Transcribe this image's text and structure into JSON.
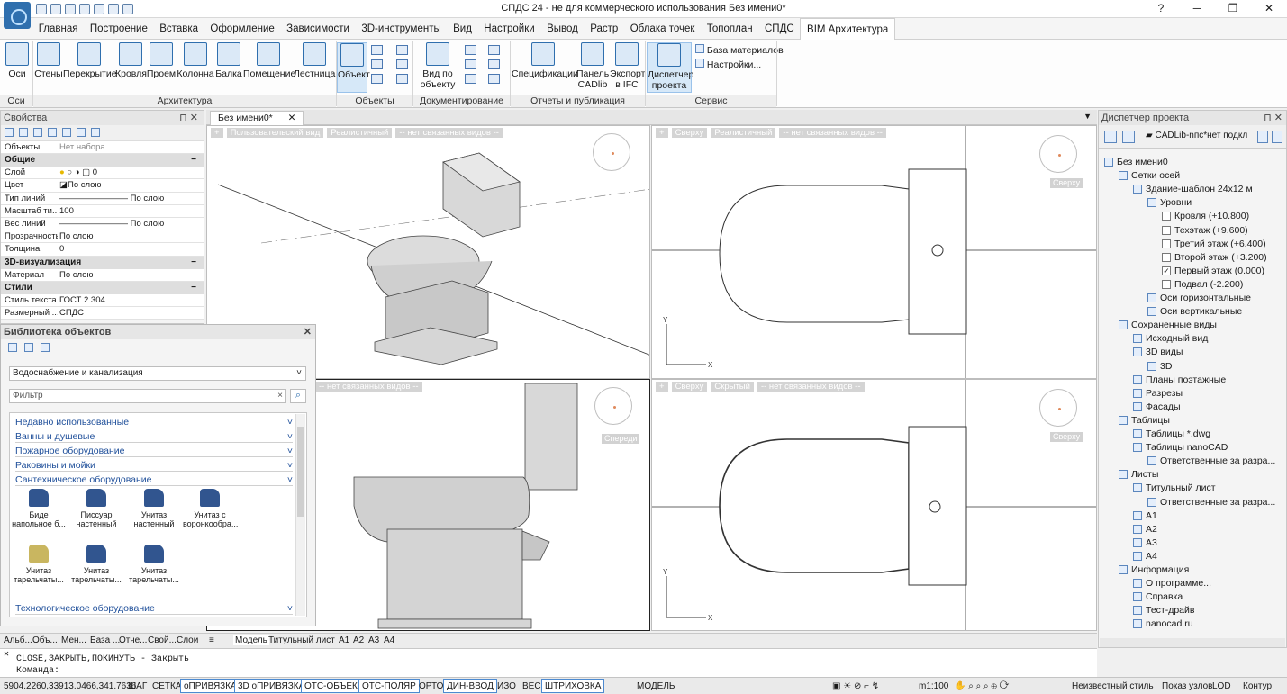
{
  "app": {
    "title": "СПДС 24 - не для коммерческого использования Без имени0*"
  },
  "menu": [
    "Главная",
    "Построение",
    "Вставка",
    "Оформление",
    "Зависимости",
    "3D-инструменты",
    "Вид",
    "Настройки",
    "Вывод",
    "Растр",
    "Облака точек",
    "Топоплан",
    "СПДС",
    "BIM Архитектура"
  ],
  "ribbon": {
    "buttons": [
      "Оси",
      "Стены",
      "Перекрытие",
      "Кровля",
      "Проем",
      "Колонна",
      "Балка",
      "Помещение",
      "Лестница",
      "Объект",
      "Вид по объекту",
      "Спецификации",
      "Панель CADlib",
      "Экспорт в IFC",
      "Диспетчер проекта"
    ],
    "side_links": [
      "База материалов",
      "Настройки..."
    ],
    "groups": [
      "Оси",
      "Архитектура",
      "Объекты",
      "Документирование",
      "Отчеты и публикация",
      "Сервис"
    ]
  },
  "properties": {
    "header": "Свойства",
    "objects_label": "Объекты",
    "objects_value": "Нет набора",
    "general": "Общие",
    "rows": [
      {
        "k": "Слой",
        "v": "0"
      },
      {
        "k": "Цвет",
        "v": "По слою"
      },
      {
        "k": "Тип линий",
        "v": "По слою"
      },
      {
        "k": "Масштаб ти...",
        "v": "100"
      },
      {
        "k": "Вес линий",
        "v": "По слою"
      },
      {
        "k": "Прозрачность",
        "v": "По слою"
      },
      {
        "k": "Толщина",
        "v": "0"
      }
    ],
    "viz_cat": "3D-визуализация",
    "material_k": "Материал",
    "material_v": "По слою",
    "styles_cat": "Стили",
    "style_rows": [
      {
        "k": "Стиль текста",
        "v": "ГОСТ 2.304"
      },
      {
        "k": "Размерный ...",
        "v": "СПДС"
      }
    ]
  },
  "library": {
    "header": "Библиотека объектов",
    "section": "Водоснабжение и канализация",
    "filter_placeholder": "Фильтр",
    "categories": [
      "Недавно использованные",
      "Ванны и душевые",
      "Пожарное оборудование",
      "Раковины и мойки",
      "Сантехническое оборудование"
    ],
    "items": [
      {
        "label": "Биде напольное б..."
      },
      {
        "label": "Писсуар настенный"
      },
      {
        "label": "Унитаз настенный"
      },
      {
        "label": "Унитаз с воронкообра..."
      },
      {
        "label": "Унитаз тарельчаты..."
      },
      {
        "label": "Унитаз тарельчаты..."
      },
      {
        "label": "Унитаз тарельчаты..."
      }
    ],
    "last_category": "Технологическое оборудование"
  },
  "doc_tab": "Без имени0*",
  "viewports": {
    "tl": [
      "+",
      "Пользовательский вид",
      "Реалистичный",
      "-- нет связанных видов --"
    ],
    "tr": [
      "+",
      "Сверху",
      "Реалистичный",
      "-- нет связанных видов --"
    ],
    "tr_compass": "Сверху",
    "bl": [
      "-- нет связанных видов --"
    ],
    "bl_compass": "Спереди",
    "br": [
      "+",
      "Сверху",
      "Скрытый",
      "-- нет связанных видов --"
    ],
    "br_compass": "Сверху"
  },
  "project_manager": {
    "header": "Диспетчер проекта",
    "db": "CADLib-nпс*нет подкл",
    "tree": [
      {
        "l": "Без имени0",
        "d": 0
      },
      {
        "l": "Сетки осей",
        "d": 1
      },
      {
        "l": "Здание-шаблон 24x12 м",
        "d": 2
      },
      {
        "l": "Уровни",
        "d": 3
      },
      {
        "l": "Кровля (+10.800)",
        "d": 4,
        "c": false
      },
      {
        "l": "Техэтаж (+9.600)",
        "d": 4,
        "c": false
      },
      {
        "l": "Третий этаж (+6.400)",
        "d": 4,
        "c": false
      },
      {
        "l": "Второй этаж (+3.200)",
        "d": 4,
        "c": false
      },
      {
        "l": "Первый этаж (0.000)",
        "d": 4,
        "c": true
      },
      {
        "l": "Подвал (-2.200)",
        "d": 4,
        "c": false
      },
      {
        "l": "Оси горизонтальные",
        "d": 3
      },
      {
        "l": "Оси вертикальные",
        "d": 3
      },
      {
        "l": "Сохраненные виды",
        "d": 1
      },
      {
        "l": "Исходный вид",
        "d": 2
      },
      {
        "l": "3D виды",
        "d": 2
      },
      {
        "l": "3D",
        "d": 3
      },
      {
        "l": "Планы поэтажные",
        "d": 2
      },
      {
        "l": "Разрезы",
        "d": 2
      },
      {
        "l": "Фасады",
        "d": 2
      },
      {
        "l": "Таблицы",
        "d": 1
      },
      {
        "l": "Таблицы *.dwg",
        "d": 2
      },
      {
        "l": "Таблицы nanoCAD",
        "d": 2
      },
      {
        "l": "Ответственные за разра...",
        "d": 3
      },
      {
        "l": "Листы",
        "d": 1
      },
      {
        "l": "Титульный лист",
        "d": 2
      },
      {
        "l": "Ответственные за разра...",
        "d": 3
      },
      {
        "l": "A1",
        "d": 2
      },
      {
        "l": "A2",
        "d": 2
      },
      {
        "l": "A3",
        "d": 2
      },
      {
        "l": "A4",
        "d": 2
      },
      {
        "l": "Информация",
        "d": 1
      },
      {
        "l": "О программе...",
        "d": 2
      },
      {
        "l": "Справка",
        "d": 2
      },
      {
        "l": "Тест-драйв",
        "d": 2
      },
      {
        "l": "nanocad.ru",
        "d": 2
      }
    ]
  },
  "bottom_tabs": {
    "left": [
      "Альб...",
      "Объ...",
      "Мен...",
      "База ...",
      "Отче...",
      "Свой...",
      "Слои"
    ],
    "layouts": [
      "Модель",
      "Титульный лист",
      "A1",
      "A2",
      "A3",
      "A4"
    ]
  },
  "command": {
    "line1": "CLOSE,ЗАКРЫТЬ,ПОКИНУТЬ - Закрыть",
    "prompt": "Команда:"
  },
  "status": {
    "coords": "5904.2260,33913.0466,341.7636",
    "toggles": [
      "ШАГ",
      "СЕТКА",
      "оПРИВЯЗКА",
      "3D оПРИВЯЗКА",
      "ОТС-ОБЪЕКТ",
      "ОТС-ПОЛЯР",
      "ОРТО",
      "ДИН-ВВОД",
      "ИЗО",
      "ВЕС",
      "ШТРИХОВКА"
    ],
    "model": "МОДЕЛЬ",
    "scale": "m1:100",
    "style": "Неизвестный стиль",
    "nodes": "Показ узлов",
    "lod": "LOD",
    "contour": "Контур"
  }
}
